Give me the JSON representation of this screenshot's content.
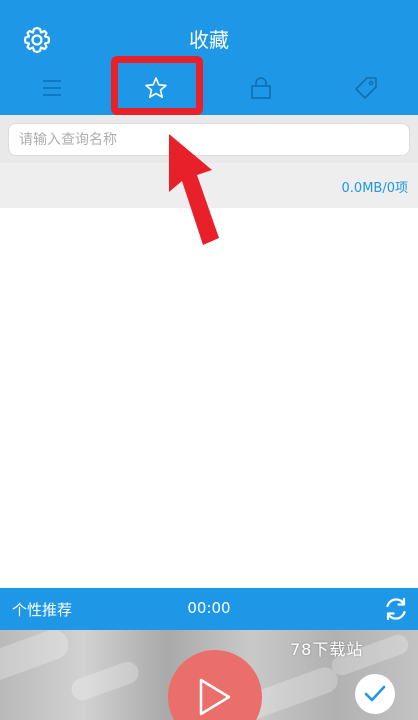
{
  "header": {
    "title": "收藏",
    "settings_icon": "gear-icon",
    "background_color": "#1e98e6"
  },
  "tabs": [
    {
      "icon": "list-icon"
    },
    {
      "icon": "star-icon",
      "selected": true
    },
    {
      "icon": "lock-icon"
    },
    {
      "icon": "tag-icon"
    }
  ],
  "search": {
    "placeholder": "请输入查询名称",
    "value": ""
  },
  "storage": {
    "summary": "0.0MB/0项"
  },
  "player": {
    "recommend_label": "个性推荐",
    "time": "00:00",
    "refresh_icon": "refresh-icon"
  },
  "bottom": {
    "watermark": "78下载站",
    "play_icon": "play-icon",
    "confirm_icon": "check-icon"
  },
  "annotation": {
    "highlight_color": "#e8202a"
  }
}
